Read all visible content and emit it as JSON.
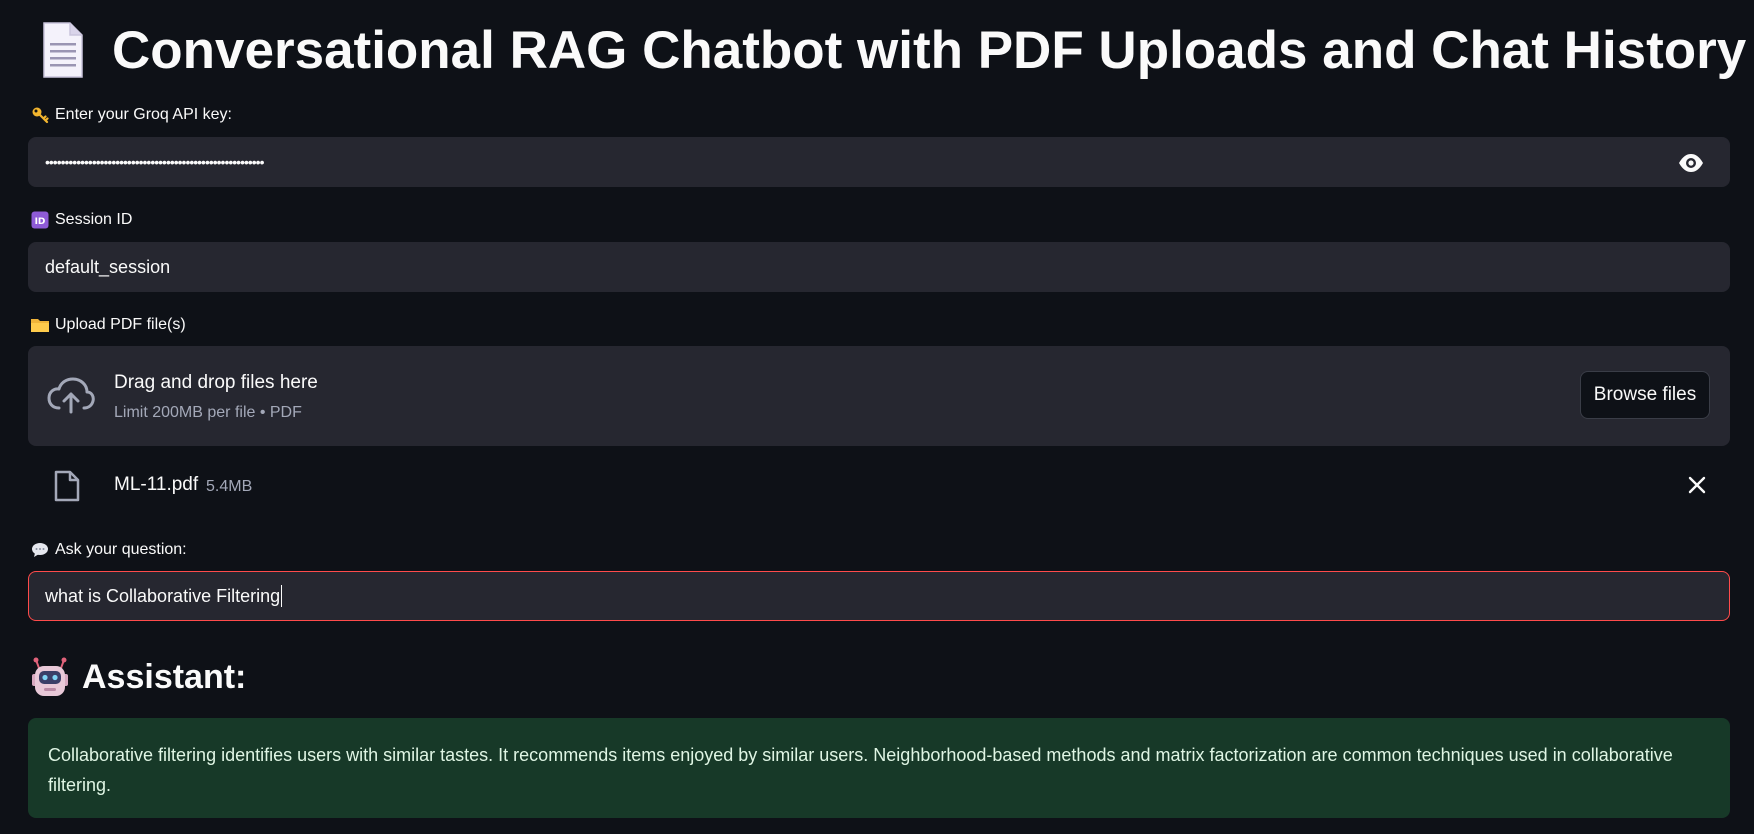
{
  "page": {
    "title": "Conversational RAG Chatbot with PDF Uploads and Chat History",
    "title_icon": "page-facing-up-icon"
  },
  "api_key": {
    "label": "Enter your Groq API key:",
    "label_icon": "key-icon",
    "value": "••••••••••••••••••••••••••••••••••••••••••••••••••••••••",
    "toggle_icon": "eye-icon"
  },
  "session": {
    "label": "Session ID",
    "label_icon": "id-badge-icon",
    "value": "default_session"
  },
  "upload": {
    "label": "Upload PDF file(s)",
    "label_icon": "folder-icon",
    "drop_text": "Drag and drop files here",
    "limit_text": "Limit 200MB per file • PDF",
    "browse_label": "Browse files",
    "files": [
      {
        "name": "ML-11.pdf",
        "size": "5.4MB"
      }
    ]
  },
  "question": {
    "label": "Ask your question:",
    "label_icon": "speech-balloon-icon",
    "value": "what is Collaborative Filtering"
  },
  "assistant": {
    "heading": "Assistant:",
    "heading_icon": "robot-icon",
    "answer": "Collaborative filtering identifies users with similar tastes. It recommends items enjoyed by similar users. Neighborhood-based methods and matrix factorization are common techniques used in collaborative filtering."
  },
  "colors": {
    "background": "#0e1117",
    "input_background": "#262730",
    "focus_border": "#ff4b4b",
    "answer_background": "#173928",
    "answer_text": "#dff5e4"
  }
}
